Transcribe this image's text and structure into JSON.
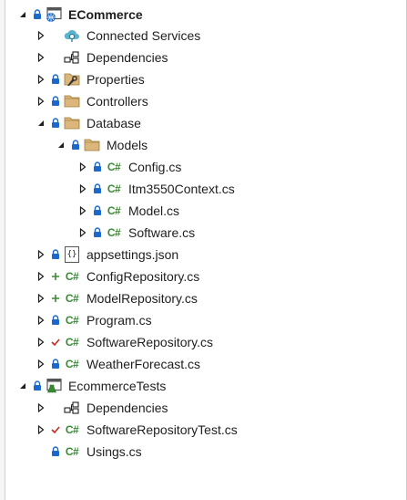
{
  "tree": {
    "project": "ECommerce",
    "connected_services": "Connected Services",
    "dependencies": "Dependencies",
    "properties": "Properties",
    "controllers": "Controllers",
    "database": "Database",
    "models": "Models",
    "model_files": [
      "Config.cs",
      "Itm3550Context.cs",
      "Model.cs",
      "Software.cs"
    ],
    "appsettings": "appsettings.json",
    "config_repository": "ConfigRepository.cs",
    "model_repository": "ModelRepository.cs",
    "program": "Program.cs",
    "software_repository": "SoftwareRepository.cs",
    "weather_forecast": "WeatherForecast.cs",
    "test_project": "EcommerceTests",
    "test_dependencies": "Dependencies",
    "software_repository_test": "SoftwareRepositoryTest.cs",
    "usings": "Usings.cs"
  },
  "icons": {
    "cs_glyph": "C#",
    "json_glyph": "{}"
  },
  "colors": {
    "accent_green": "#388a34",
    "lock_blue": "#1b6ac9",
    "folder_tan": "#dcb67a",
    "add_green": "#388a34",
    "check_red": "#c42b1c"
  }
}
